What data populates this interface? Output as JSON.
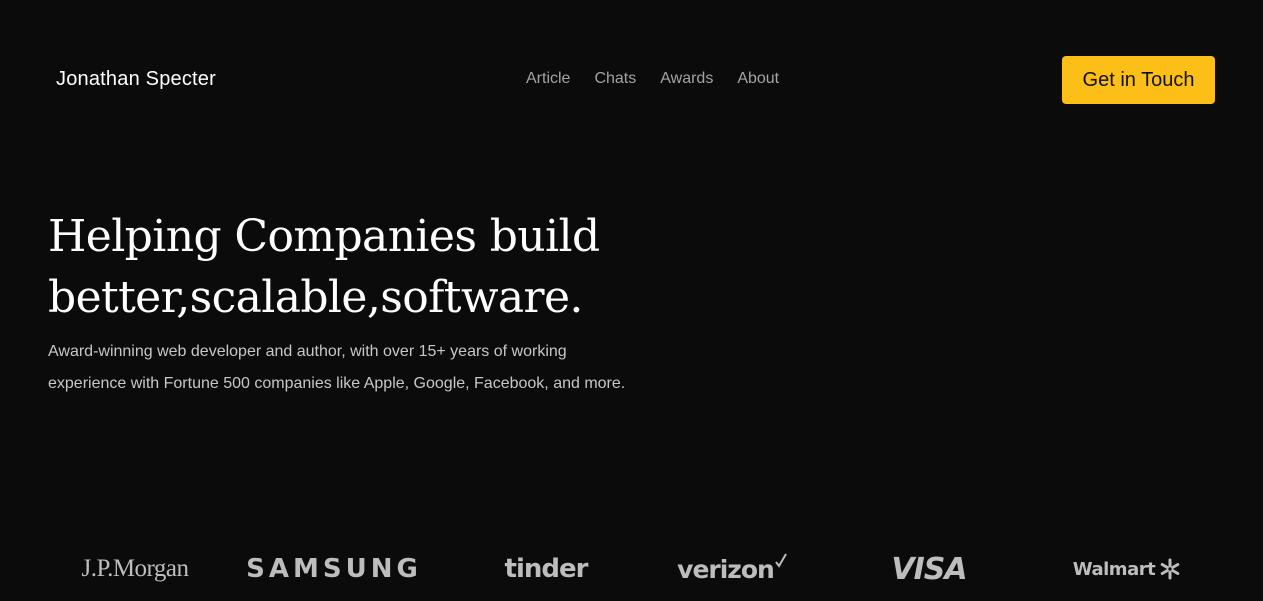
{
  "header": {
    "brand": "Jonathan Specter",
    "nav": [
      "Article",
      "Chats",
      "Awards",
      "About"
    ],
    "cta_label": "Get in Touch"
  },
  "hero": {
    "title_line1": "Helping Companies build",
    "title_line2": "better,scalable,software.",
    "description": "Award-winning web developer and author, with over 15+ years of working experience with Fortune 500 companies like Apple, Google, Facebook, and more."
  },
  "logos": {
    "jpmorgan": "J.P.Morgan",
    "samsung": "SAMSUNG",
    "tinder": "tinder",
    "verizon": "verizon",
    "visa": "VISA",
    "walmart": "Walmart"
  },
  "colors": {
    "background": "#0b0b0b",
    "accent": "#fbbf17",
    "logo_gray": "#bdbdbd",
    "nav_gray": "#a3a3a3"
  },
  "icons": {
    "verizon_mark": "checkmark-icon",
    "walmart_mark": "spark-icon"
  }
}
